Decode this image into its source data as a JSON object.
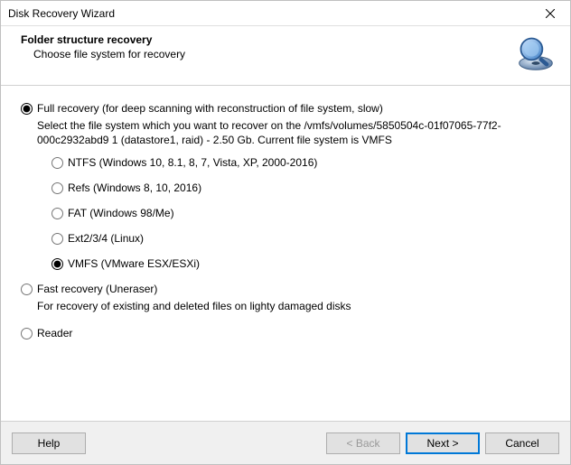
{
  "window": {
    "title": "Disk Recovery Wizard"
  },
  "header": {
    "title": "Folder structure recovery",
    "subtitle": "Choose file system for recovery"
  },
  "modes": {
    "full": {
      "label": "Full recovery (for deep scanning with reconstruction of file system, slow)",
      "description": "Select the file system which you want to recover on the /vmfs/volumes/5850504c-01f07065-77f2-000c2932abd9 1 (datastore1, raid) - 2.50 Gb. Current file system is VMFS",
      "selected": true,
      "filesystems": [
        {
          "id": "ntfs",
          "label": "NTFS (Windows 10, 8.1, 8, 7, Vista, XP, 2000-2016)",
          "selected": false
        },
        {
          "id": "refs",
          "label": "Refs (Windows 8, 10, 2016)",
          "selected": false
        },
        {
          "id": "fat",
          "label": "FAT (Windows 98/Me)",
          "selected": false
        },
        {
          "id": "ext",
          "label": "Ext2/3/4 (Linux)",
          "selected": false
        },
        {
          "id": "vmfs",
          "label": "VMFS (VMware ESX/ESXi)",
          "selected": true
        }
      ]
    },
    "fast": {
      "label": "Fast recovery (Uneraser)",
      "description": "For recovery of existing and deleted files on lighty damaged disks",
      "selected": false
    },
    "reader": {
      "label": "Reader",
      "selected": false
    }
  },
  "buttons": {
    "help": "Help",
    "back": "< Back",
    "next": "Next >",
    "cancel": "Cancel"
  }
}
